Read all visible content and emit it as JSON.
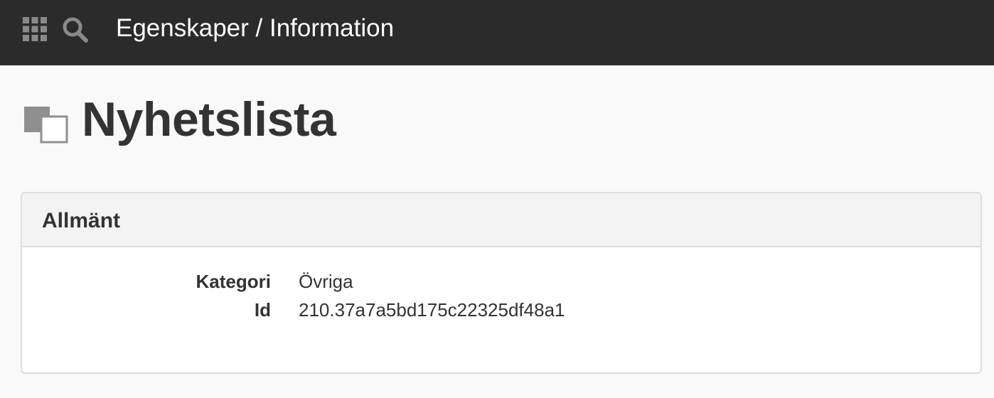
{
  "topbar": {
    "apps_icon": "apps-grid-icon",
    "search_icon": "search-icon",
    "title": "Egenskaper / Information"
  },
  "page": {
    "icon": "copy-squares-icon",
    "title": "Nyhetslista"
  },
  "panel": {
    "title": "Allmänt",
    "properties": [
      {
        "label": "Kategori",
        "value": "Övriga"
      },
      {
        "label": "Id",
        "value": "210.37a7a5bd175c22325df48a1"
      }
    ]
  },
  "colors": {
    "topbar_bg": "#2b2b2b",
    "page_bg": "#f9f9f9",
    "panel_heading_bg": "#f3f3f3",
    "text": "#333333"
  }
}
